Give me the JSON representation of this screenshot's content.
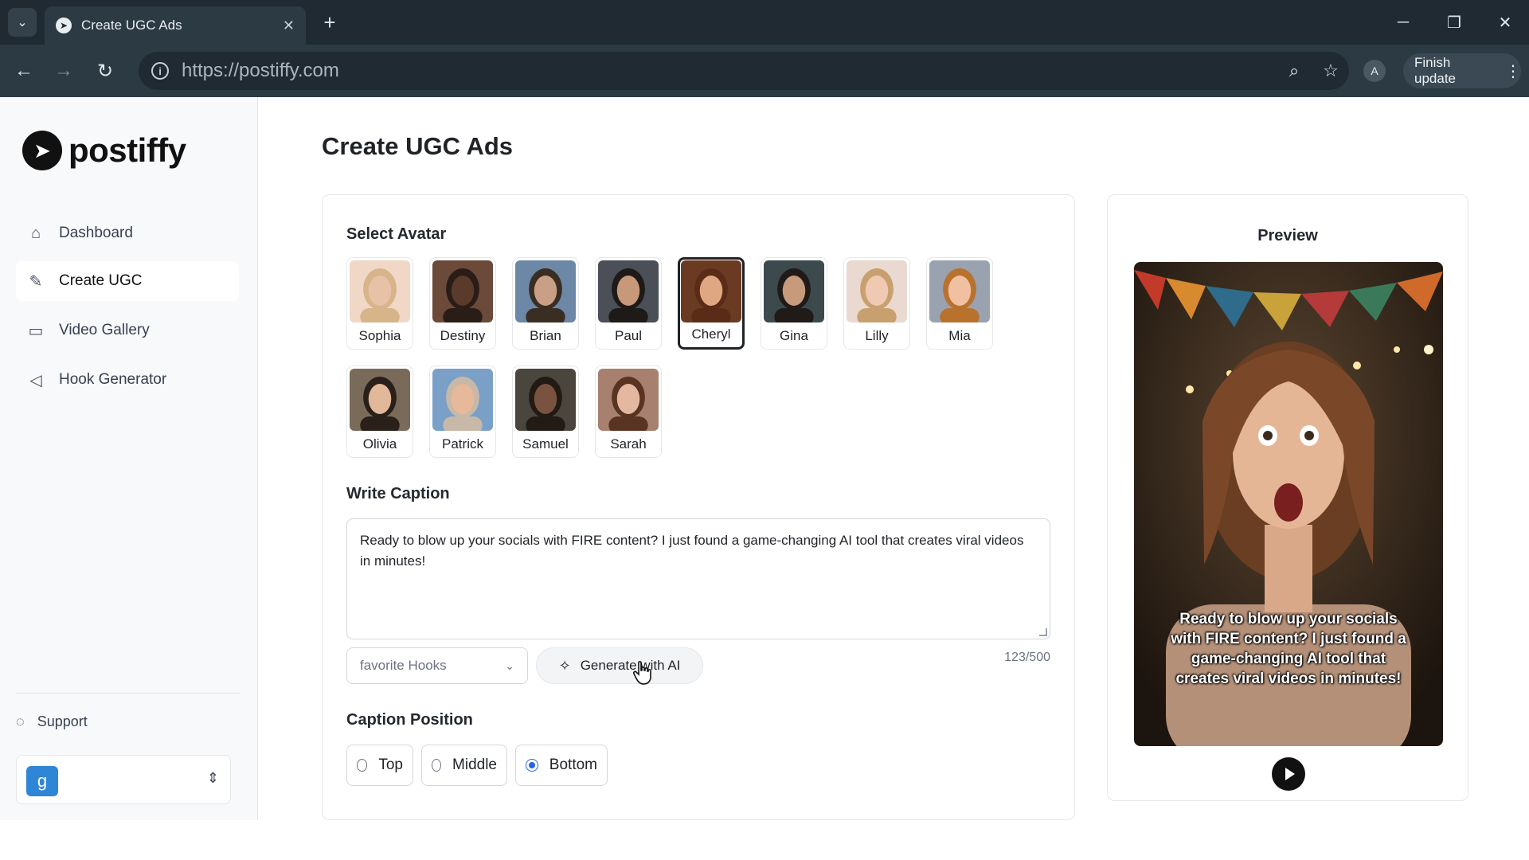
{
  "browser": {
    "tab_title": "Create UGC Ads",
    "url": "https://postiffy.com",
    "profile_initial": "A",
    "finish_update_label": "Finish update"
  },
  "sidebar": {
    "brand": "postiffy",
    "items": [
      {
        "label": "Dashboard",
        "icon": "home-icon"
      },
      {
        "label": "Create UGC",
        "icon": "edit-icon"
      },
      {
        "label": "Video Gallery",
        "icon": "video-icon"
      },
      {
        "label": "Hook Generator",
        "icon": "megaphone-icon"
      }
    ],
    "support_label": "Support",
    "account_initial": "g"
  },
  "page": {
    "title": "Create UGC Ads"
  },
  "form": {
    "select_avatar_label": "Select Avatar",
    "avatars": [
      {
        "name": "Sophia",
        "selected": false
      },
      {
        "name": "Destiny",
        "selected": false
      },
      {
        "name": "Brian",
        "selected": false
      },
      {
        "name": "Paul",
        "selected": false
      },
      {
        "name": "Cheryl",
        "selected": true
      },
      {
        "name": "Gina",
        "selected": false
      },
      {
        "name": "Lilly",
        "selected": false
      },
      {
        "name": "Mia",
        "selected": false
      },
      {
        "name": "Olivia",
        "selected": false
      },
      {
        "name": "Patrick",
        "selected": false
      },
      {
        "name": "Samuel",
        "selected": false
      },
      {
        "name": "Sarah",
        "selected": false
      }
    ],
    "write_caption_label": "Write Caption",
    "caption_value": "Ready to blow up your socials with FIRE content? I just found a game-changing AI tool that creates viral videos in minutes!",
    "hooks_select_value": "favorite Hooks",
    "generate_label": "Generate with AI",
    "char_counter": "123/500",
    "caption_position_label": "Caption Position",
    "positions": [
      {
        "label": "Top",
        "checked": false
      },
      {
        "label": "Middle",
        "checked": false
      },
      {
        "label": "Bottom",
        "checked": true
      }
    ]
  },
  "preview": {
    "title": "Preview",
    "overlay_caption": "Ready to blow up your socials with FIRE content? I just found a game-changing AI tool that creates viral videos in minutes!"
  },
  "colors": {
    "accent": "#2563eb",
    "chrome_dark": "#1f2a33",
    "account_badge": "#2f86d6"
  }
}
